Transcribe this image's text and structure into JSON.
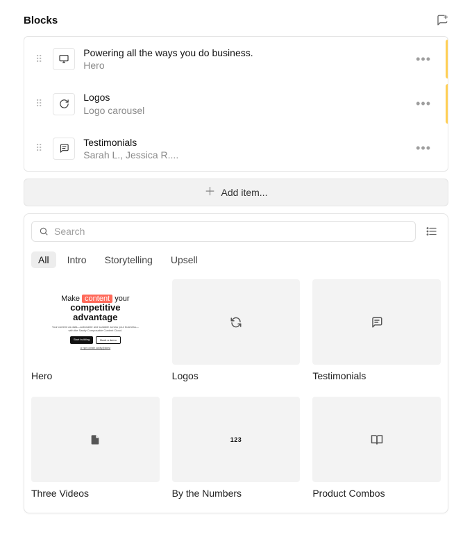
{
  "section_title": "Blocks",
  "blocks": [
    {
      "icon": "monitor",
      "title": "Powering all the ways you do business.",
      "subtitle": "Hero",
      "marked": true
    },
    {
      "icon": "refresh",
      "title": "Logos",
      "subtitle": "Logo carousel",
      "marked": true
    },
    {
      "icon": "chat",
      "title": "Testimonials",
      "subtitle": "Sarah L., Jessica R....",
      "marked": false
    }
  ],
  "add_item_label": "Add item...",
  "picker": {
    "search_placeholder": "Search",
    "tabs": [
      "All",
      "Intro",
      "Storytelling",
      "Upsell"
    ],
    "active_tab_index": 0,
    "cards": [
      {
        "kind": "hero",
        "label": "Hero"
      },
      {
        "kind": "refresh-icon",
        "label": "Logos"
      },
      {
        "kind": "chat-icon",
        "label": "Testimonials"
      },
      {
        "kind": "file-icon",
        "label": "Three Videos"
      },
      {
        "kind": "numbers",
        "label": "By the Numbers"
      },
      {
        "kind": "book-icon",
        "label": "Product Combos"
      }
    ],
    "hero_preview": {
      "line1_a": "Make",
      "line1_h": "content",
      "line1_b": "your",
      "big1": "competitive",
      "big2": "advantage",
      "copy": "Your content as data—actionable and scalable across your business—with the Sanity Composable Content Cloud.",
      "btn_primary": "Start building",
      "btn_secondary": "Book a demo",
      "tiny": "or npm create sanity@latest"
    },
    "numbers_badge": "123"
  }
}
